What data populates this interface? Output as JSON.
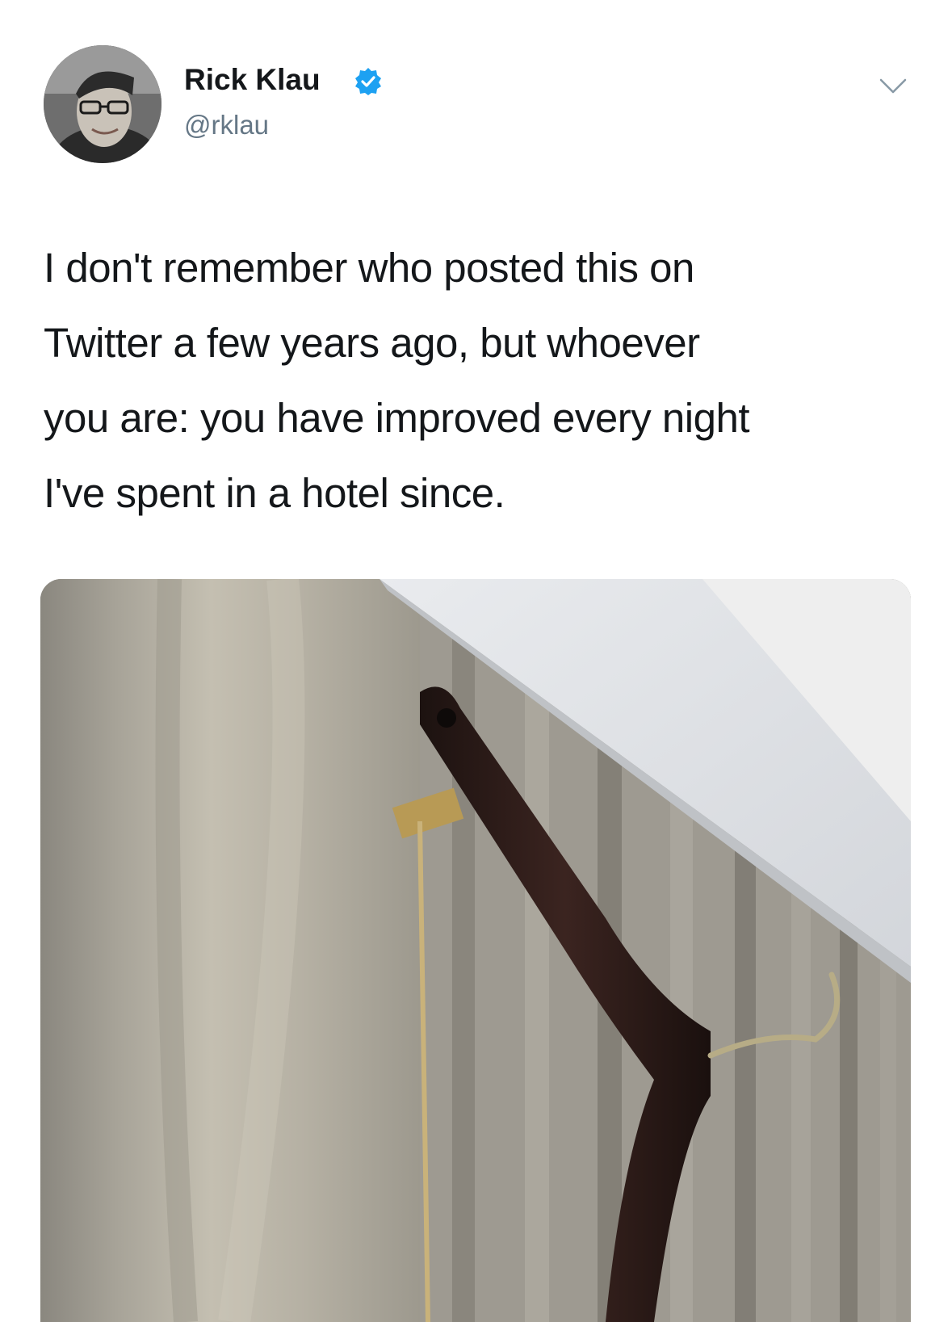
{
  "tweet": {
    "author": {
      "display_name": "Rick Klau",
      "handle": "@rklau",
      "verified": true
    },
    "text_lines": [
      "I don't remember who posted this on",
      "Twitter a few years ago, but whoever",
      "you are: you have improved every night",
      "I've spent in a hotel since."
    ],
    "icons": {
      "avatar": "profile-photo",
      "verified": "verified-badge-icon",
      "menu": "chevron-down-icon"
    },
    "colors": {
      "verified_blue": "#1da1f2",
      "handle_gray": "#657786",
      "text": "#14171a"
    }
  }
}
